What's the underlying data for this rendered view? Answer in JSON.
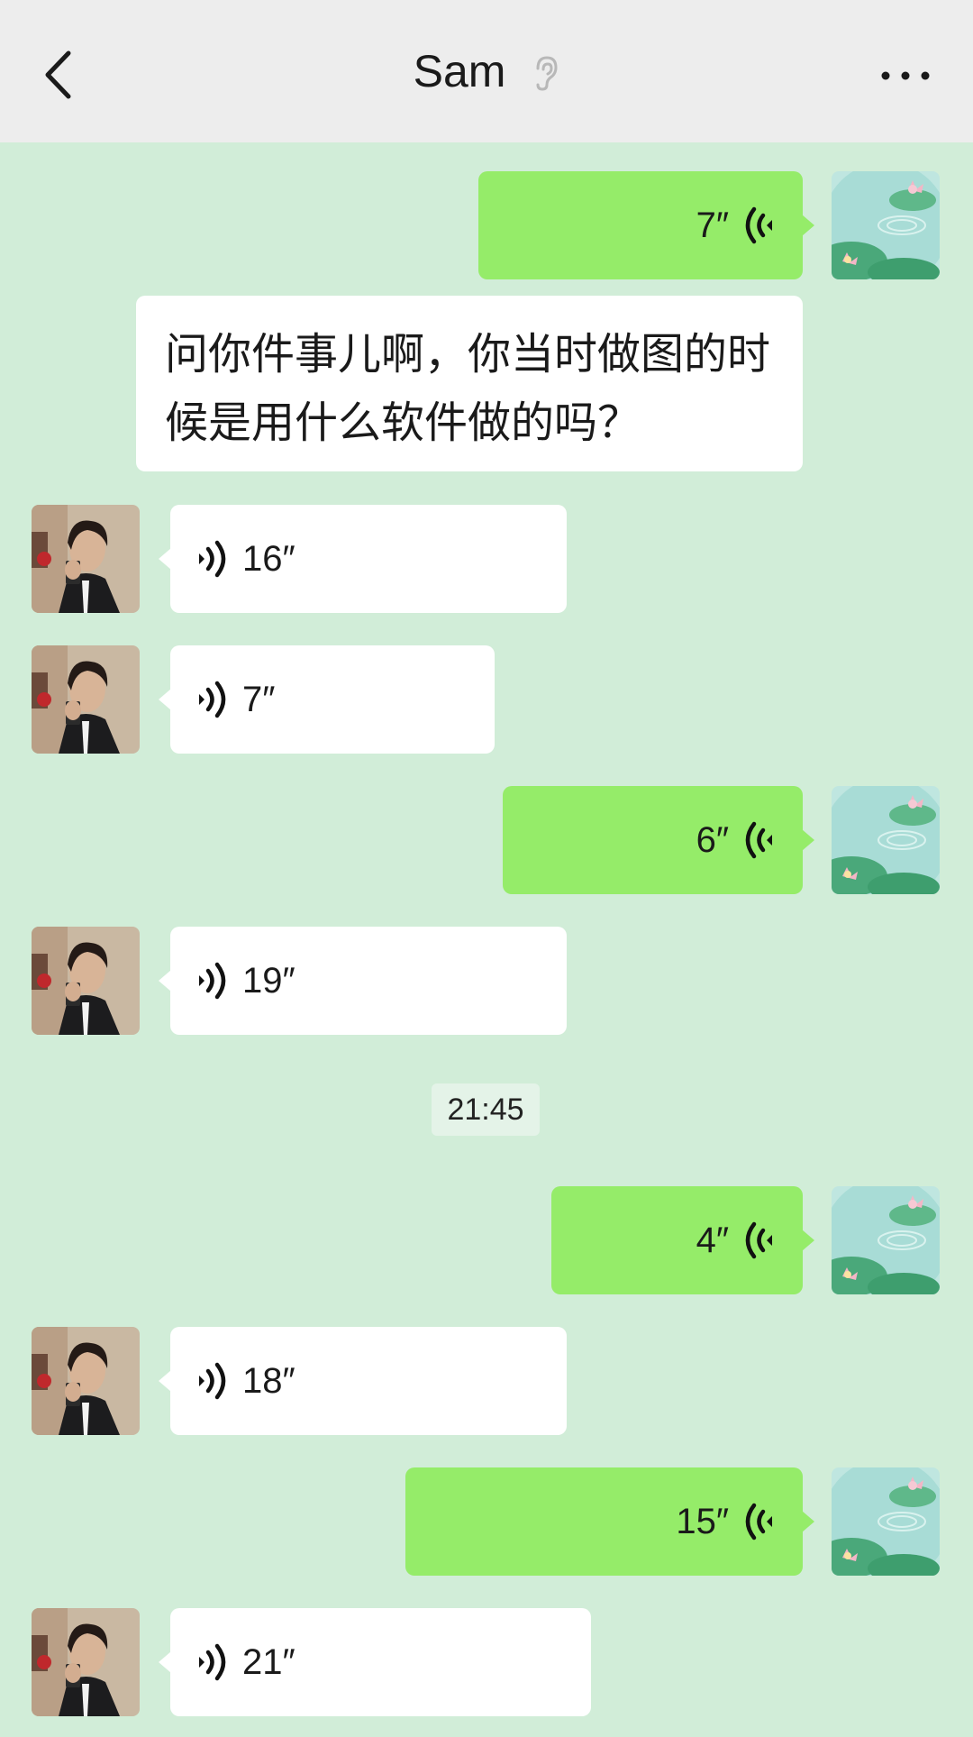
{
  "header": {
    "title": "Sam"
  },
  "messages": [
    {
      "side": "out",
      "duration": "7″"
    },
    {
      "side": "in",
      "text": "问你件事儿啊，你当时做图的时候是用什么软件做的吗？"
    },
    {
      "side": "in",
      "duration": "16″"
    },
    {
      "side": "in",
      "duration": "7″"
    },
    {
      "side": "out",
      "duration": "6″"
    },
    {
      "side": "in",
      "duration": "19″"
    },
    {
      "side": "out",
      "duration": "4″"
    },
    {
      "side": "in",
      "duration": "18″"
    },
    {
      "side": "out",
      "duration": "15″"
    },
    {
      "side": "in",
      "duration": "21″"
    }
  ],
  "timestamp": "21:45",
  "colors": {
    "background": "#d1edd8",
    "header": "#ededed",
    "outgoing_bubble": "#95ec69",
    "incoming_bubble": "#ffffff"
  },
  "icons": {
    "back": "chevron-left-icon",
    "ear": "ear-icon",
    "more": "more-dots-icon",
    "voice": "voice-wave-icon"
  }
}
